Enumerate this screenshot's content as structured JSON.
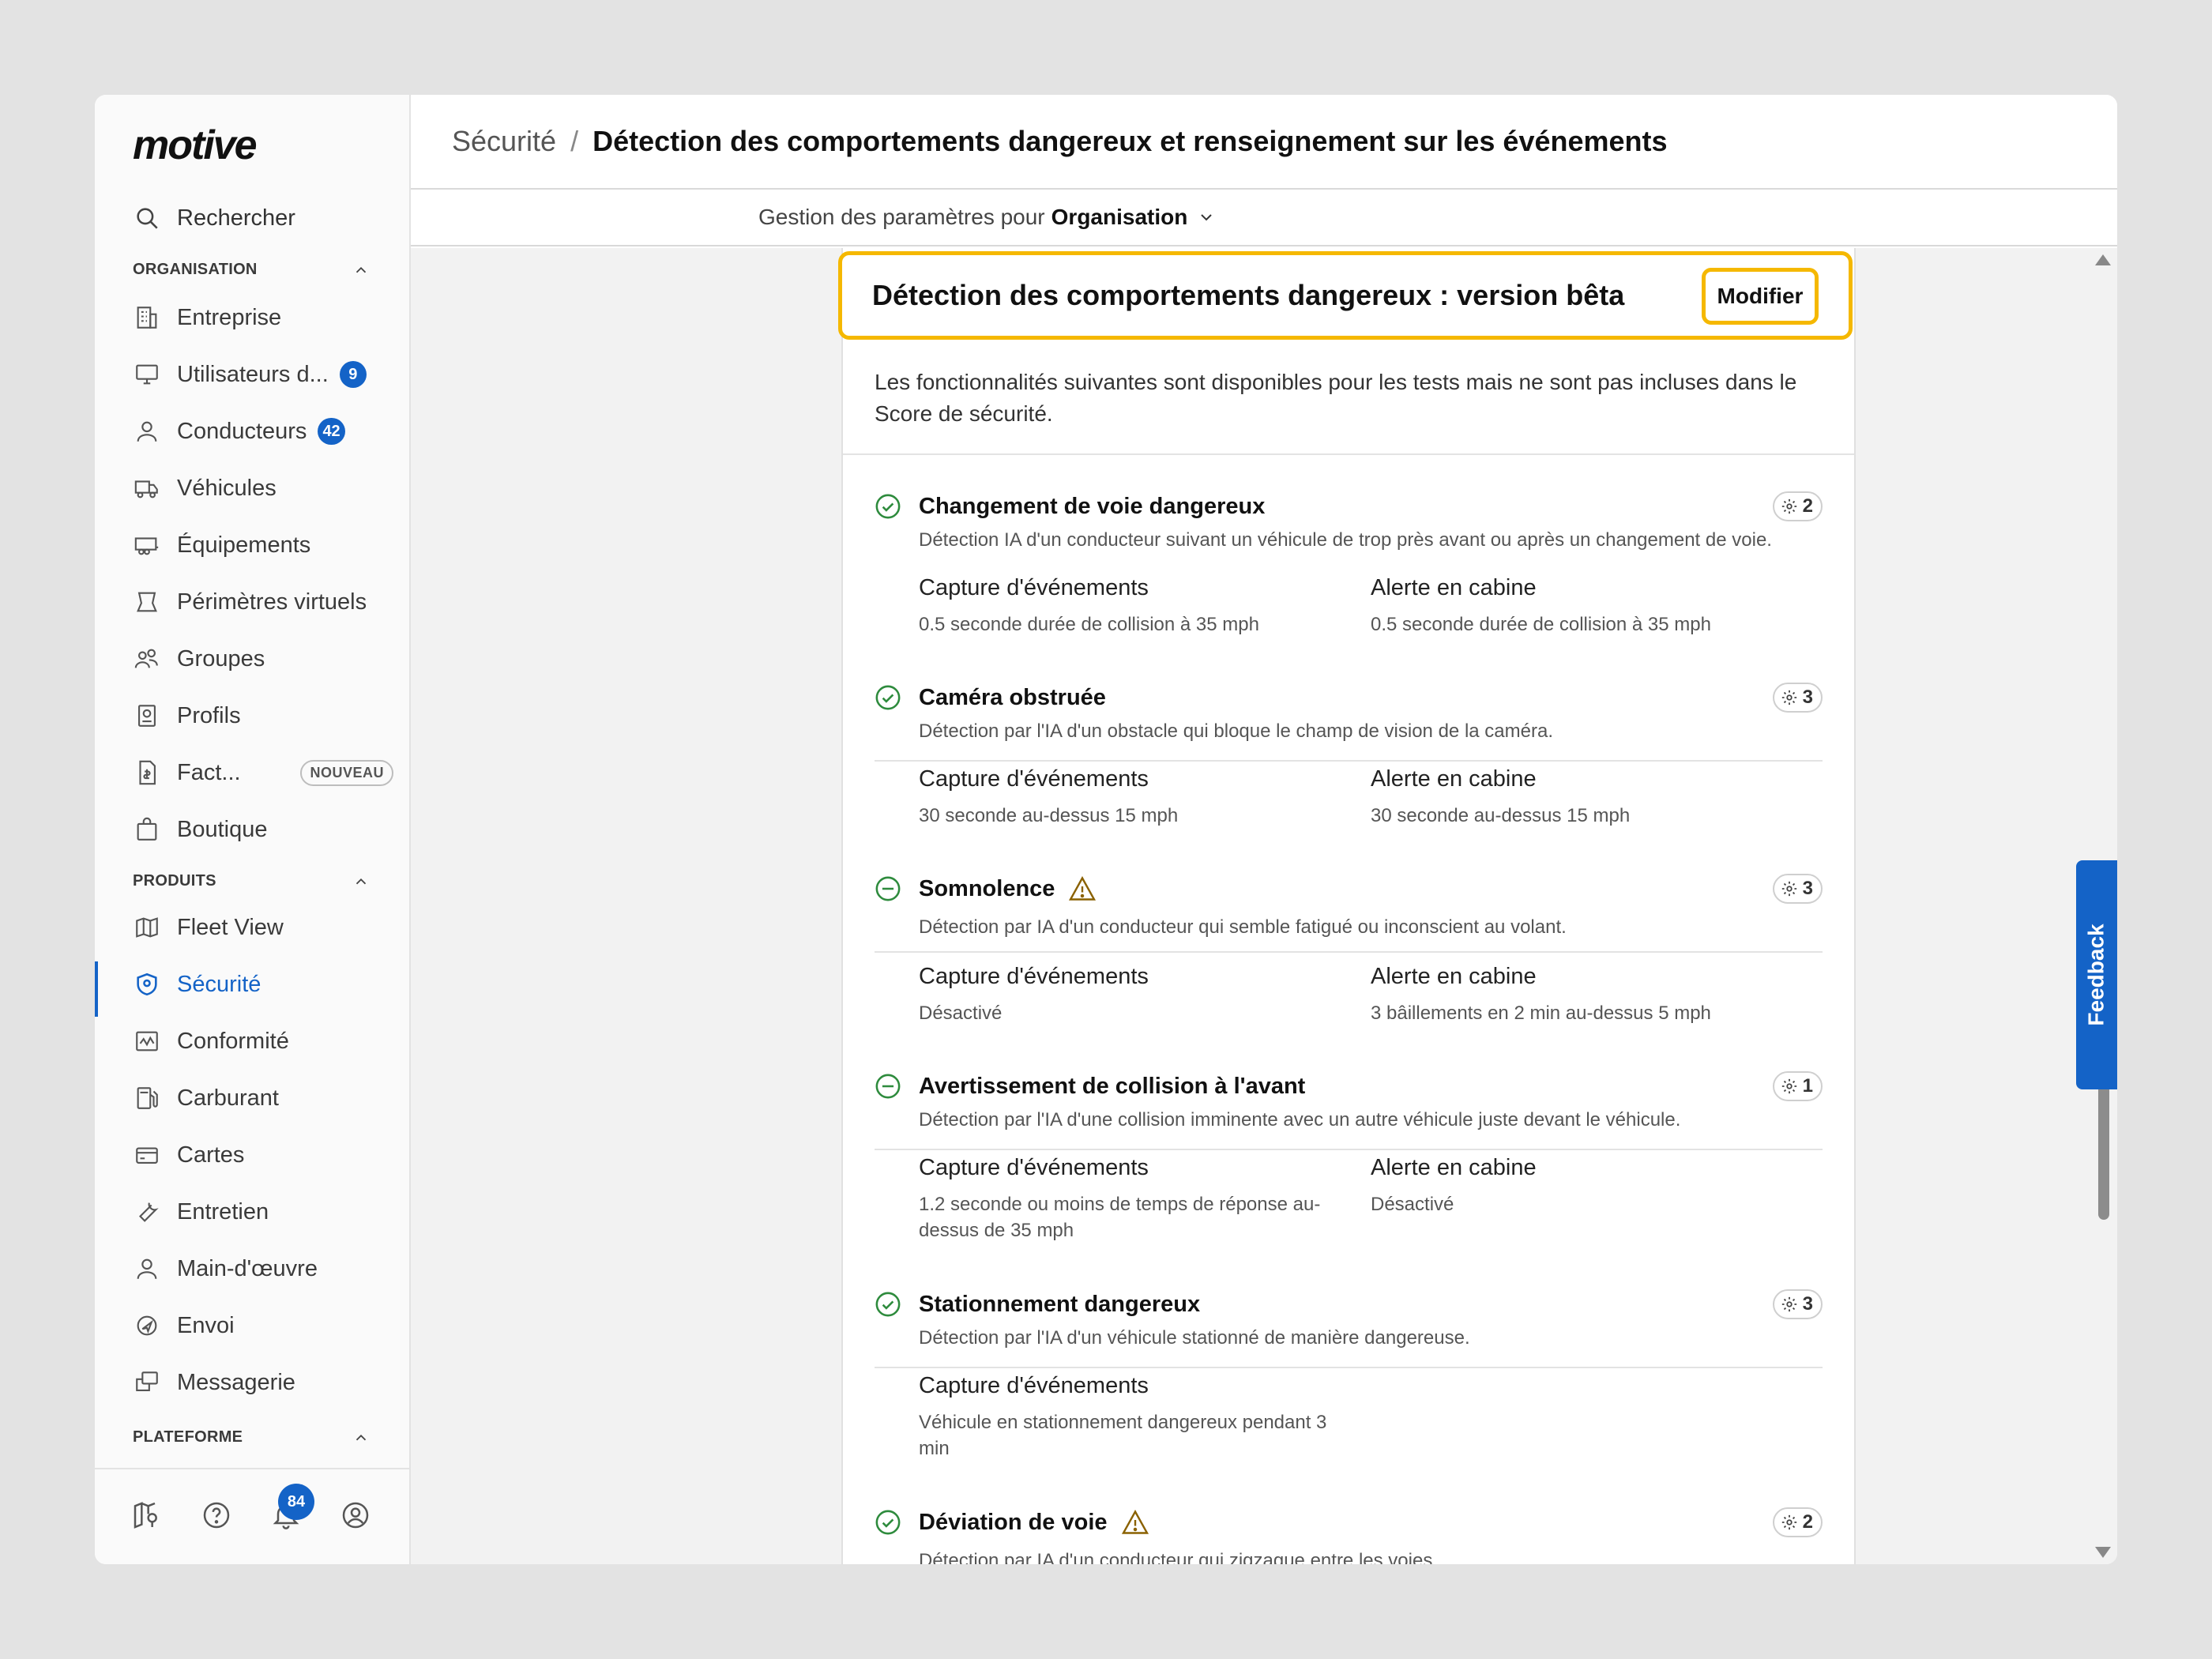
{
  "app": {
    "logo": "motive"
  },
  "sidebar": {
    "search_label": "Rechercher",
    "sections": {
      "organisation": "ORGANISATION",
      "produits": "PRODUITS",
      "plateforme": "PLATEFORME"
    },
    "org_items": [
      {
        "label": "Entreprise",
        "icon": "building-icon"
      },
      {
        "label": "Utilisateurs d...",
        "icon": "monitor-icon",
        "count": "9"
      },
      {
        "label": "Conducteurs",
        "icon": "person-icon",
        "count": "42"
      },
      {
        "label": "Véhicules",
        "icon": "truck-icon"
      },
      {
        "label": "Équipements",
        "icon": "trailer-icon"
      },
      {
        "label": "Périmètres virtuels",
        "icon": "geofence-icon"
      },
      {
        "label": "Groupes",
        "icon": "group-icon"
      },
      {
        "label": "Profils",
        "icon": "profile-icon"
      },
      {
        "label": "Fact...",
        "icon": "invoice-icon",
        "pill": "NOUVEAU"
      },
      {
        "label": "Boutique",
        "icon": "bag-icon"
      }
    ],
    "product_items": [
      {
        "label": "Fleet View",
        "icon": "map-icon"
      },
      {
        "label": "Sécurité",
        "icon": "shield-icon",
        "active": true
      },
      {
        "label": "Conformité",
        "icon": "compliance-icon"
      },
      {
        "label": "Carburant",
        "icon": "fuel-icon"
      },
      {
        "label": "Cartes",
        "icon": "card-icon"
      },
      {
        "label": "Entretien",
        "icon": "wrench-icon"
      },
      {
        "label": "Main-d'œuvre",
        "icon": "worker-icon"
      },
      {
        "label": "Envoi",
        "icon": "dispatch-icon"
      },
      {
        "label": "Messagerie",
        "icon": "message-icon"
      }
    ],
    "notifications_count": "84"
  },
  "header": {
    "breadcrumb_root": "Sécurité",
    "breadcrumb_sep": "/",
    "breadcrumb_current": "Détection des comportements dangereux et renseignement sur les événements"
  },
  "subheader": {
    "prefix": "Gestion des paramètres pour",
    "org": "Organisation"
  },
  "panel": {
    "title": "Détection des comportements dangereux : version bêta",
    "edit_label": "Modifier",
    "intro": "Les fonctionnalités suivantes sont disponibles pour les tests mais ne sont pas incluses dans le Score de sécurité."
  },
  "columns": {
    "capture": "Capture d'événements",
    "alert": "Alerte en cabine"
  },
  "features": [
    {
      "title": "Changement de voie dangereux",
      "status": "enabled",
      "badge": "2",
      "desc": "Détection IA d'un conducteur suivant un véhicule de trop près avant ou après un changement de voie.",
      "capture": "0.5 seconde durée de collision à 35 mph",
      "alert": "0.5 seconde durée de collision à 35 mph"
    },
    {
      "title": "Caméra obstruée",
      "status": "enabled",
      "badge": "3",
      "desc": "Détection par l'IA d'un obstacle qui bloque le champ de vision de la caméra.",
      "capture": "30 seconde au-dessus 15 mph",
      "alert": "30 seconde au-dessus 15 mph"
    },
    {
      "title": "Somnolence",
      "status": "partial",
      "warning": true,
      "badge": "3",
      "desc": "Détection par IA d'un conducteur qui semble fatigué ou inconscient au volant.",
      "capture": "Désactivé",
      "alert": "3 bâillements en 2 min au-dessus 5 mph"
    },
    {
      "title": "Avertissement de collision à l'avant",
      "status": "partial",
      "badge": "1",
      "desc": "Détection par l'IA d'une collision imminente avec un autre véhicule juste devant le véhicule.",
      "capture": "1.2 seconde ou moins de temps de réponse au-dessus de 35 mph",
      "alert": "Désactivé"
    },
    {
      "title": "Stationnement dangereux",
      "status": "enabled",
      "badge": "3",
      "desc": "Détection par l'IA d'un véhicule stationné de manière dangereuse.",
      "capture": "Véhicule en stationnement dangereux pendant 3 min"
    },
    {
      "title": "Déviation de voie",
      "status": "enabled",
      "warning": true,
      "badge": "2",
      "desc": "Détection par IA d'un conducteur qui zigzague entre les voies."
    }
  ],
  "feedback_label": "Feedback",
  "colors": {
    "accent": "#1463c7",
    "highlight": "#f5b800",
    "success": "#2e8b3d"
  }
}
